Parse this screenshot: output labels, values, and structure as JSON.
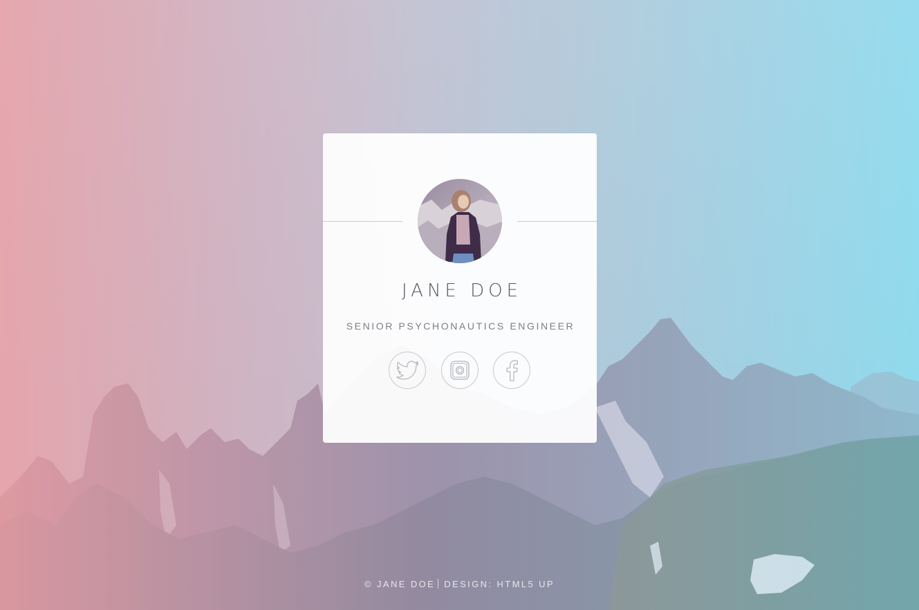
{
  "profile": {
    "name": "JANE DOE",
    "tagline": "SENIOR PSYCHONAUTICS ENGINEER"
  },
  "social": [
    {
      "label": "Twitter",
      "icon": "twitter-icon"
    },
    {
      "label": "Instagram",
      "icon": "instagram-icon"
    },
    {
      "label": "Facebook",
      "icon": "facebook-icon"
    }
  ],
  "footer": {
    "copyright": "© JANE DOE",
    "design": "DESIGN: HTML5 UP"
  },
  "colors": {
    "gradient_left": "#e8a6a8",
    "gradient_right": "#8fdcef",
    "text_primary": "#555560",
    "icon_stroke": "#b3b3bb"
  }
}
